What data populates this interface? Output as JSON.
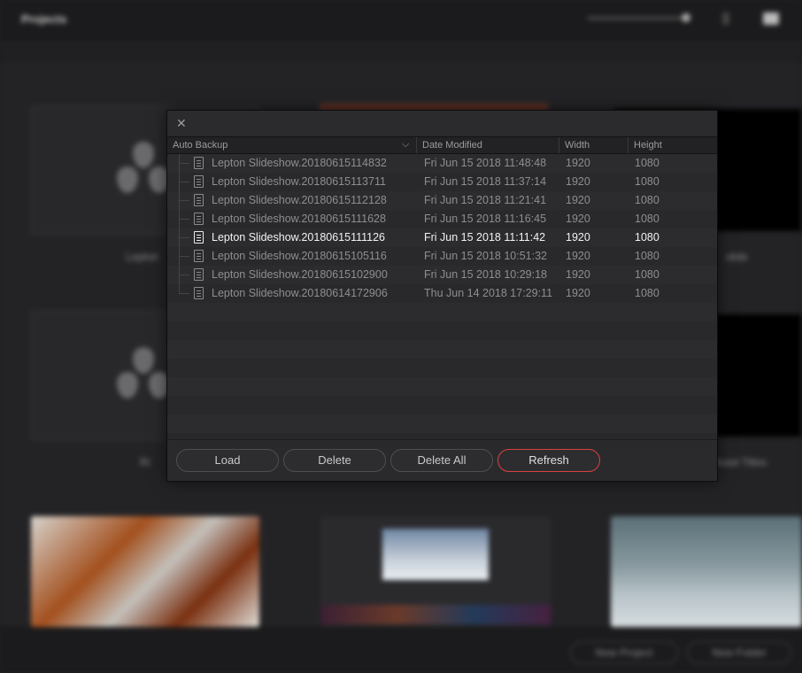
{
  "background": {
    "title": "Projects",
    "project_labels": [
      "Lepton",
      "slide",
      "Ri",
      "dcast Titles"
    ],
    "footer_buttons": [
      "New Project",
      "New Folder"
    ]
  },
  "dialog": {
    "columns": {
      "name": "Auto Backup",
      "date": "Date Modified",
      "width": "Width",
      "height": "Height"
    },
    "rows": [
      {
        "name": "Lepton Slideshow.20180615114832",
        "date": "Fri Jun 15 2018 11:48:48",
        "width": "1920",
        "height": "1080",
        "selected": false
      },
      {
        "name": "Lepton Slideshow.20180615113711",
        "date": "Fri Jun 15 2018 11:37:14",
        "width": "1920",
        "height": "1080",
        "selected": false
      },
      {
        "name": "Lepton Slideshow.20180615112128",
        "date": "Fri Jun 15 2018 11:21:41",
        "width": "1920",
        "height": "1080",
        "selected": false
      },
      {
        "name": "Lepton Slideshow.20180615111628",
        "date": "Fri Jun 15 2018 11:16:45",
        "width": "1920",
        "height": "1080",
        "selected": false
      },
      {
        "name": "Lepton Slideshow.20180615111126",
        "date": "Fri Jun 15 2018 11:11:42",
        "width": "1920",
        "height": "1080",
        "selected": true
      },
      {
        "name": "Lepton Slideshow.20180615105116",
        "date": "Fri Jun 15 2018 10:51:32",
        "width": "1920",
        "height": "1080",
        "selected": false
      },
      {
        "name": "Lepton Slideshow.20180615102900",
        "date": "Fri Jun 15 2018 10:29:18",
        "width": "1920",
        "height": "1080",
        "selected": false
      },
      {
        "name": "Lepton Slideshow.20180614172906",
        "date": "Thu Jun 14 2018 17:29:11",
        "width": "1920",
        "height": "1080",
        "selected": false
      }
    ],
    "buttons": {
      "load": "Load",
      "delete": "Delete",
      "delete_all": "Delete All",
      "refresh": "Refresh"
    },
    "accent_color": "#d8423d"
  }
}
